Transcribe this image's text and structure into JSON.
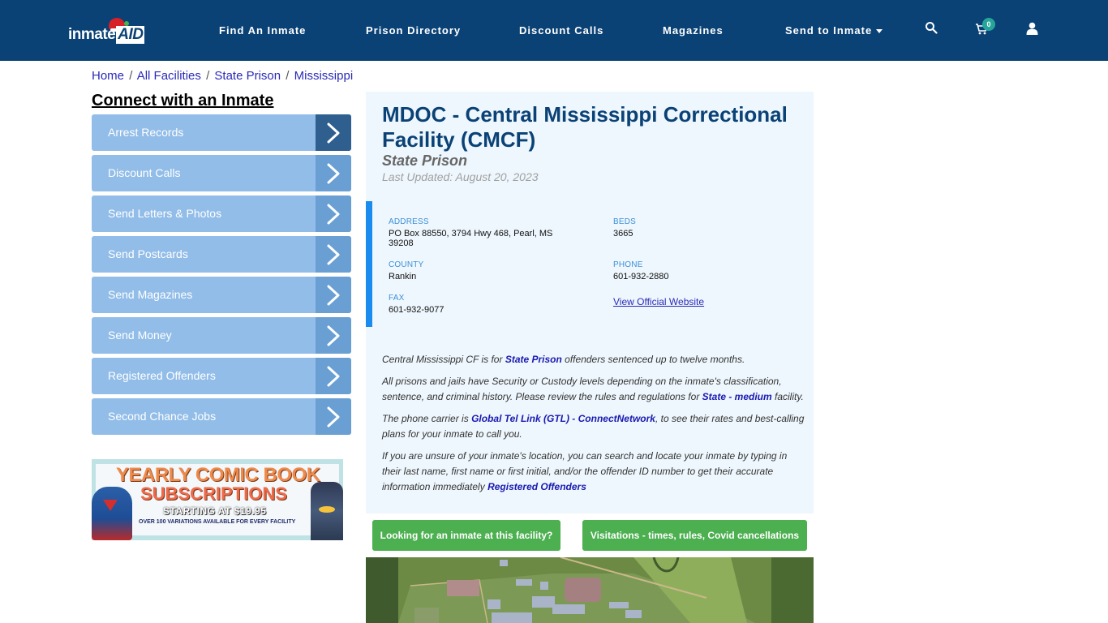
{
  "header": {
    "logo_text": "inmate",
    "logo_accent": "AID",
    "nav": [
      {
        "label": "Find An Inmate"
      },
      {
        "label": "Prison Directory"
      },
      {
        "label": "Discount Calls"
      },
      {
        "label": "Magazines"
      },
      {
        "label": "Send to Inmate",
        "has_dropdown": true
      }
    ],
    "icons": [
      "search-icon",
      "cart-icon",
      "user-icon"
    ],
    "cart_count": "0",
    "brand_color": "#0b4276",
    "badge_color": "#26a69a"
  },
  "breadcrumb": {
    "items": [
      "Home",
      "All Facilities",
      "State Prison",
      "Mississippi"
    ],
    "separator": "/"
  },
  "sidebar": {
    "title": "Connect with an Inmate",
    "items": [
      {
        "label": "Arrest Records"
      },
      {
        "label": "Discount Calls"
      },
      {
        "label": "Send Letters & Photos"
      },
      {
        "label": "Send Postcards"
      },
      {
        "label": "Send Magazines"
      },
      {
        "label": "Send Money"
      },
      {
        "label": "Registered Offenders"
      },
      {
        "label": "Second Chance Jobs"
      }
    ],
    "ad": {
      "line1": "YEARLY COMIC BOOK",
      "line2": "SUBSCRIPTIONS",
      "line3": "STARTING AT $19.95",
      "line4": "OVER 100 VARIATIONS AVAILABLE FOR EVERY FACILITY"
    }
  },
  "facility": {
    "title": "MDOC - Central Mississippi Correctional Facility (CMCF)",
    "type": "State Prison",
    "last_updated": "Last Updated: August 20, 2023",
    "address_label": "ADDRESS",
    "address": "PO Box 88550, 3794 Hwy 468, Pearl, MS 39208",
    "beds_label": "BEDS",
    "beds": "3665",
    "county_label": "COUNTY",
    "county": "Rankin",
    "phone_label": "PHONE",
    "phone": "601-932-2880",
    "fax_label": "FAX",
    "fax": "601-932-9077",
    "website_link": "View Official Website"
  },
  "description": {
    "p1_a": "Central Mississippi CF is for ",
    "p1_link": "State Prison",
    "p1_b": " offenders sentenced up to twelve months.",
    "p2_a": "All prisons and jails have Security or Custody levels depending on the inmate's classification, sentence, and criminal history. Please review the rules and regulations for ",
    "p2_link": "State - medium",
    "p2_b": " facility.",
    "p3_a": "The phone carrier is ",
    "p3_link": "Global Tel Link (GTL) - ConnectNetwork",
    "p3_b": ", to see their rates and best-calling plans for your inmate to call you.",
    "p4_a": "If you are unsure of your inmate's location, you can search and locate your inmate by typing in their last name, first name or first initial, and/or the offender ID number to get their accurate information immediately ",
    "p4_link": "Registered Offenders"
  },
  "actions": {
    "find_inmate": "Looking for an inmate at this facility?",
    "visitations": "Visitations - times, rules, Covid cancellations"
  }
}
